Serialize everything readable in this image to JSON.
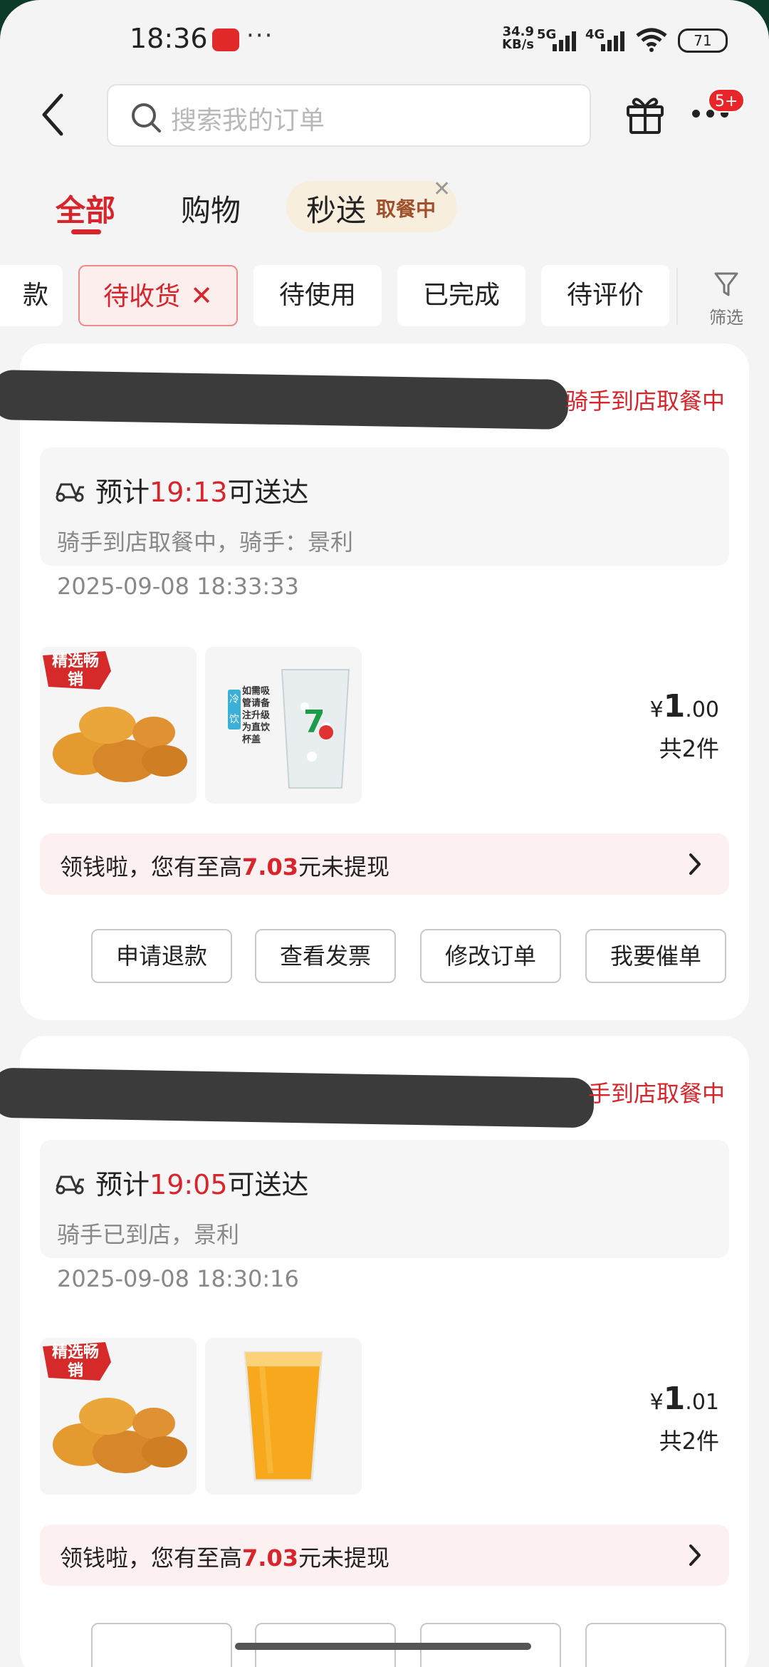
{
  "status_bar": {
    "time": "18:36",
    "dots": "···",
    "net_speed": "34.9",
    "net_speed_unit": "KB/s",
    "network_1": "5G",
    "network_2": "4G",
    "battery": "71"
  },
  "header": {
    "search_placeholder": "搜索我的订单",
    "more_badge": "5+"
  },
  "tabs": {
    "all": "全部",
    "shopping": "购物",
    "instant": "秒送",
    "instant_status": "取餐中",
    "instant_close": "✕"
  },
  "filters": {
    "partial": "款",
    "to_receive": "待收货",
    "to_receive_close": "✕",
    "to_use": "待使用",
    "completed": "已完成",
    "to_review": "待评价",
    "filter": "筛选"
  },
  "orders": [
    {
      "status": "骑手到店取餐中",
      "eta_prefix": "预计",
      "eta_time": "19:13",
      "eta_suffix": "可送达",
      "rider": "骑手到店取餐中，骑手：景利",
      "timestamp": "2025-09-08 18:33:33",
      "product_tag": "精选畅销",
      "drink_tag": "冷饮",
      "drink_note": "如需吸管请备注升级为直饮杯盖",
      "currency": "¥",
      "price_int": "1",
      "price_dec": ".00",
      "count": "共2件",
      "promo_prefix": "领钱啦，您有至高",
      "promo_amount": "7.03",
      "promo_suffix": "元未提现",
      "actions": [
        "申请退款",
        "查看发票",
        "修改订单",
        "我要催单"
      ]
    },
    {
      "status": "手到店取餐中",
      "eta_prefix": "预计",
      "eta_time": "19:05",
      "eta_suffix": "可送达",
      "rider": "骑手已到店，景利",
      "timestamp": "2025-09-08 18:30:16",
      "product_tag": "精选畅销",
      "currency": "¥",
      "price_int": "1",
      "price_dec": ".01",
      "count": "共2件",
      "promo_prefix": "领钱啦，您有至高",
      "promo_amount": "7.03",
      "promo_suffix": "元未提现"
    }
  ],
  "colors": {
    "accent": "#d8242b",
    "background": "#f4f4f4",
    "card": "#ffffff",
    "promo_bg": "#fdf0f0"
  }
}
